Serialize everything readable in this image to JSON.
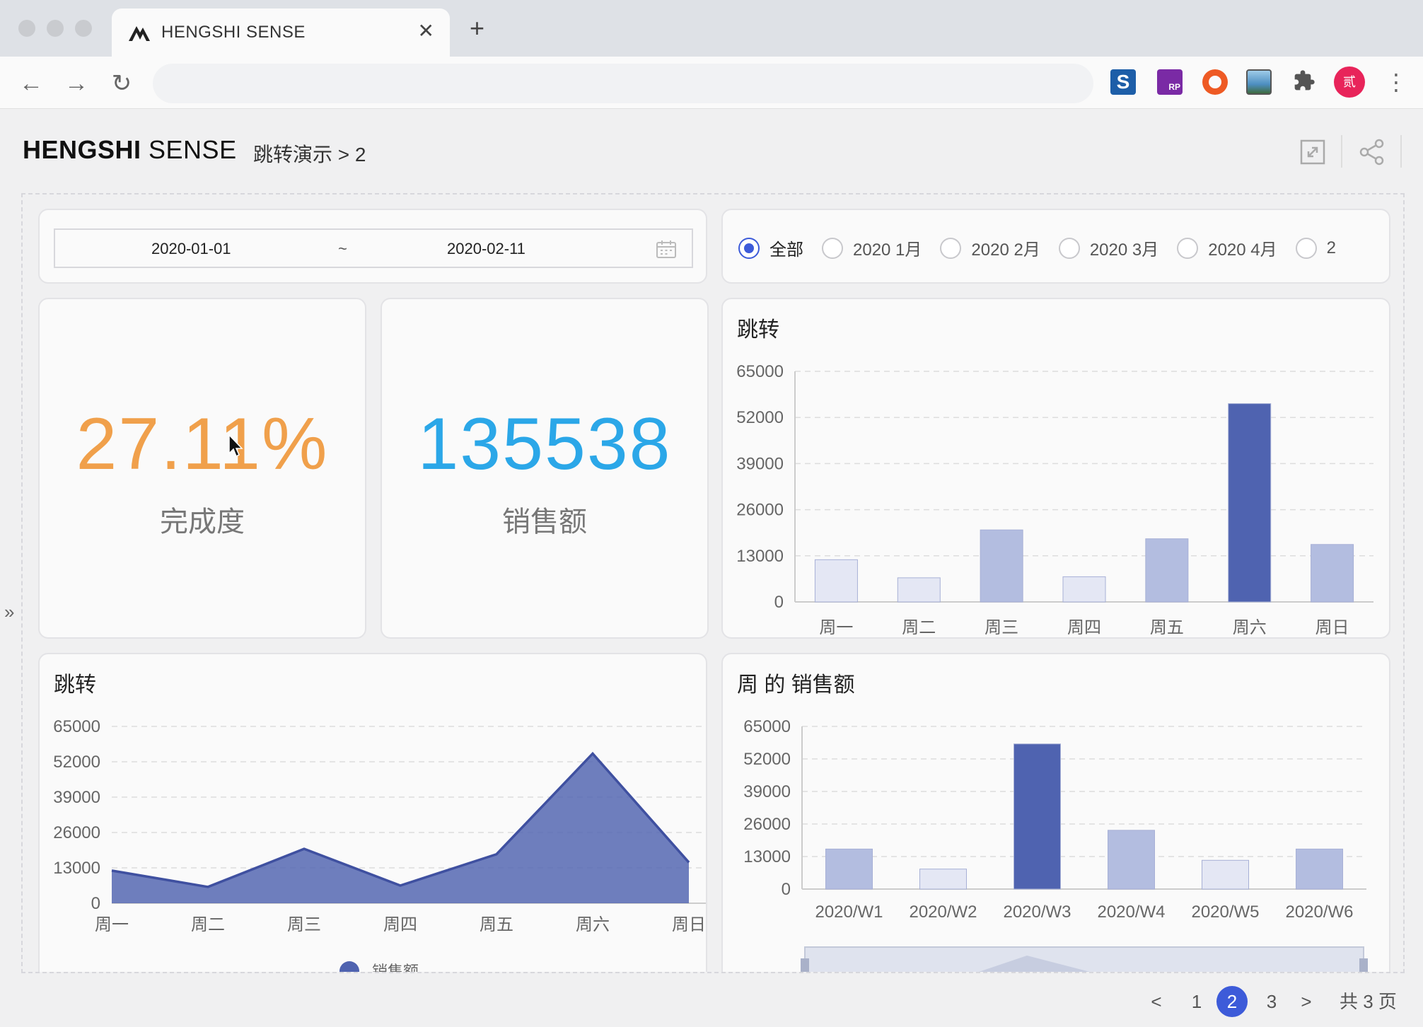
{
  "browser": {
    "tab_title": "HENGSHI SENSE",
    "tab_close": "✕",
    "new_tab": "+",
    "back": "←",
    "forward": "→",
    "reload": "↻",
    "url": "",
    "extensions": [
      "S",
      "RP"
    ],
    "avatar_text": "贰",
    "menu": "⋮"
  },
  "app": {
    "brand_bold": "HENGSHI",
    "brand_light": " SENSE",
    "breadcrumb": "跳转演示 > 2",
    "sidebar_toggle": "»"
  },
  "filters": {
    "date_start": "2020-01-01",
    "date_separator": "~",
    "date_end": "2020-02-11",
    "radios": [
      {
        "label": "全部",
        "selected": true
      },
      {
        "label": "2020 1月",
        "selected": false
      },
      {
        "label": "2020 2月",
        "selected": false
      },
      {
        "label": "2020 3月",
        "selected": false
      },
      {
        "label": "2020 4月",
        "selected": false
      },
      {
        "label": "2",
        "selected": false
      }
    ]
  },
  "kpis": {
    "completion": {
      "value": "27.11%",
      "label": "完成度",
      "color": "#f0a04b"
    },
    "sales": {
      "value": "135538",
      "label": "销售额",
      "color": "#2ba7e8"
    }
  },
  "colors": {
    "bar_dark": "#4f63b0",
    "bar_mid": "#b3bde0",
    "bar_light": "#e4e7f4",
    "grid": "#dddddd",
    "axis_text": "#666666"
  },
  "chart_data": [
    {
      "type": "bar",
      "title": "跳转",
      "categories": [
        "周一",
        "周二",
        "周三",
        "周四",
        "周五",
        "周六",
        "周日"
      ],
      "values": [
        11900,
        6800,
        20300,
        7100,
        17800,
        55900,
        16200
      ],
      "yticks": [
        0,
        13000,
        26000,
        39000,
        52000,
        65000
      ],
      "ylim": [
        0,
        65000
      ],
      "grid": true
    },
    {
      "type": "area",
      "title": "跳转",
      "categories": [
        "周一",
        "周二",
        "周三",
        "周四",
        "周五",
        "周六",
        "周日"
      ],
      "series": [
        {
          "name": "销售额",
          "values": [
            12000,
            6000,
            20000,
            6500,
            18000,
            55000,
            15000
          ]
        }
      ],
      "yticks": [
        0,
        13000,
        26000,
        39000,
        52000,
        65000
      ],
      "ylim": [
        0,
        65000
      ],
      "grid": true,
      "legend": "bottom"
    },
    {
      "type": "bar",
      "title": "周 的 销售额",
      "categories": [
        "2020/W1",
        "2020/W2",
        "2020/W3",
        "2020/W4",
        "2020/W5",
        "2020/W6"
      ],
      "values": [
        16000,
        8000,
        58000,
        23500,
        11500,
        16000
      ],
      "yticks": [
        0,
        13000,
        26000,
        39000,
        52000,
        65000
      ],
      "ylim": [
        0,
        65000
      ],
      "grid": true
    }
  ],
  "pagination": {
    "prev": "<",
    "pages": [
      "1",
      "2",
      "3"
    ],
    "current": "2",
    "next": ">",
    "total": "共 3 页"
  }
}
